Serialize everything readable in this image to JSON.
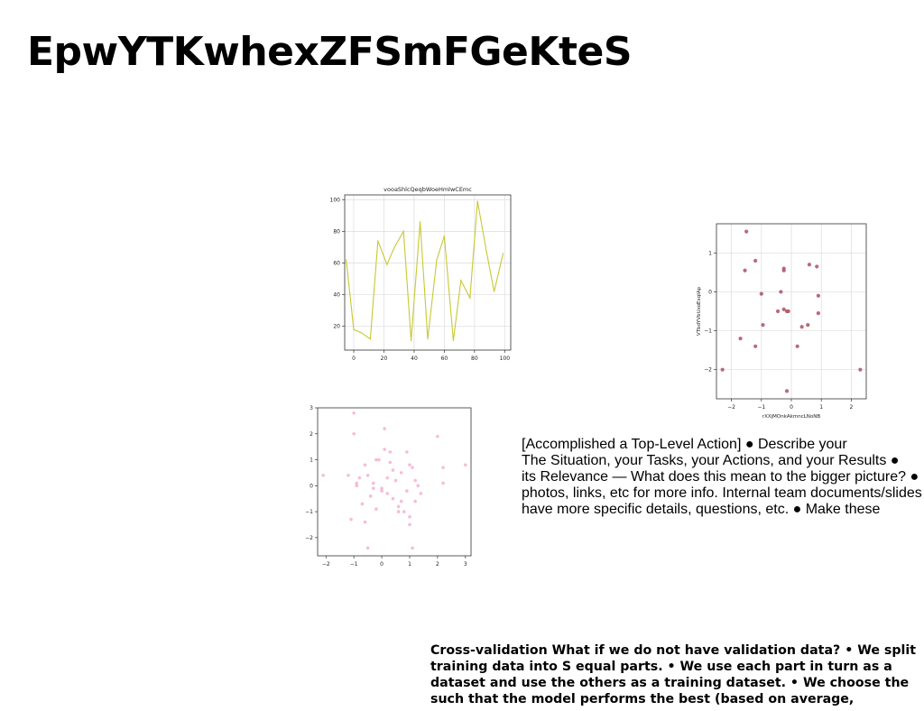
{
  "slide": {
    "title": "EpwYTKwhexZFSmFGeKteS",
    "body_lines": [
      "[Accomplished a Top-Level Action] ● Describe your",
      "The Situation, your Tasks, your Actions, and your Results ●",
      "its Relevance — What does this mean to the bigger picture? ●",
      "photos, links, etc for more info. Internal team documents/slides",
      "have more specific details, questions, etc. ● Make these"
    ],
    "footer_lines": [
      "Cross-validation What if we do not have validation data? • We split",
      "training data into S equal parts. • We use each part in turn as a",
      "dataset and use the others as a training dataset. • We choose the",
      "such that the model performs the best (based on average,"
    ]
  },
  "chart_data": [
    {
      "type": "line",
      "title": "vooaShlcQeqbWoeHmlwCEmc",
      "xlabel": "",
      "ylabel": "",
      "color": "#c8c832",
      "grid": true,
      "xlim": [
        -6,
        104
      ],
      "ylim": [
        5,
        103
      ],
      "xticks": [
        0,
        20,
        40,
        60,
        80,
        100
      ],
      "yticks": [
        20,
        40,
        60,
        80,
        100
      ],
      "x": [
        -5,
        0,
        5,
        11,
        16,
        22,
        27,
        33,
        38,
        44,
        49,
        55,
        60,
        66,
        71,
        77,
        82,
        88,
        93,
        99
      ],
      "y": [
        62,
        18,
        16,
        12,
        74,
        59,
        70,
        80,
        11,
        86,
        12,
        62,
        77,
        11,
        49,
        38,
        99,
        67,
        42,
        66
      ]
    },
    {
      "type": "scatter",
      "title": "",
      "xlabel": "rXXjMOnkAkmncLNoNB",
      "ylabel": "VTbdYVbUxoExqIAp",
      "color": "#b05a6a",
      "grid": true,
      "xlim": [
        -2.5,
        2.5
      ],
      "ylim": [
        -2.75,
        1.75
      ],
      "xticks": [
        -2,
        -1,
        0,
        1,
        2
      ],
      "yticks": [
        -2,
        -1,
        0,
        1
      ],
      "x": [
        -2.3,
        -1.5,
        -1.55,
        -1.2,
        -1.7,
        -1.2,
        -1.0,
        -0.95,
        -0.45,
        -0.35,
        -0.25,
        -0.25,
        -0.25,
        -0.15,
        -0.1,
        -0.15,
        0.2,
        0.35,
        0.55,
        0.6,
        0.85,
        0.9,
        0.9,
        2.3
      ],
      "y": [
        -2.0,
        1.55,
        0.55,
        0.8,
        -1.2,
        -1.4,
        -0.05,
        -0.85,
        -0.5,
        0.0,
        0.55,
        0.6,
        -0.45,
        -0.5,
        -0.5,
        -2.55,
        -1.4,
        -0.9,
        -0.85,
        0.7,
        0.65,
        -0.1,
        -0.55,
        -2.0
      ]
    },
    {
      "type": "scatter",
      "title": "",
      "xlabel": "",
      "ylabel": "",
      "color": "#f4a6cc",
      "grid": false,
      "xlim": [
        -2.3,
        3.2
      ],
      "ylim": [
        -2.7,
        3.0
      ],
      "xticks": [
        -2,
        -1,
        0,
        1,
        2,
        3
      ],
      "yticks": [
        -2,
        -1,
        0,
        1,
        2,
        3
      ],
      "x": [
        -2.1,
        -1.2,
        -1.1,
        -1.0,
        -0.9,
        -0.8,
        -0.7,
        -0.6,
        -0.5,
        -0.4,
        -0.3,
        -0.2,
        -0.1,
        0.0,
        0.1,
        0.2,
        0.3,
        0.4,
        0.5,
        0.6,
        0.7,
        0.8,
        0.9,
        1.0,
        1.1,
        1.2,
        1.3,
        1.4,
        2.0,
        2.2,
        2.2,
        3.0,
        -0.5,
        0.9,
        1.0,
        -0.3,
        0.3,
        1.1,
        -0.9,
        0.1,
        0.6,
        -1.0,
        0.4,
        1.0,
        -0.6,
        0.2,
        0.7,
        -0.2,
        0.0,
        1.2
      ],
      "y": [
        0.4,
        0.4,
        -1.3,
        2.8,
        0.0,
        0.3,
        -0.7,
        0.8,
        0.4,
        -0.4,
        0.1,
        -0.9,
        1.0,
        -0.2,
        2.2,
        -0.3,
        1.3,
        0.6,
        0.2,
        -0.8,
        0.5,
        -1.0,
        -0.2,
        -1.5,
        0.7,
        -0.6,
        0.0,
        -0.3,
        1.9,
        0.7,
        0.1,
        0.8,
        -2.4,
        1.3,
        -1.2,
        -0.1,
        0.9,
        -2.4,
        0.1,
        1.4,
        -1.0,
        2.0,
        -0.5,
        0.8,
        -1.4,
        0.3,
        -0.6,
        1.0,
        -0.1,
        0.2
      ]
    }
  ]
}
